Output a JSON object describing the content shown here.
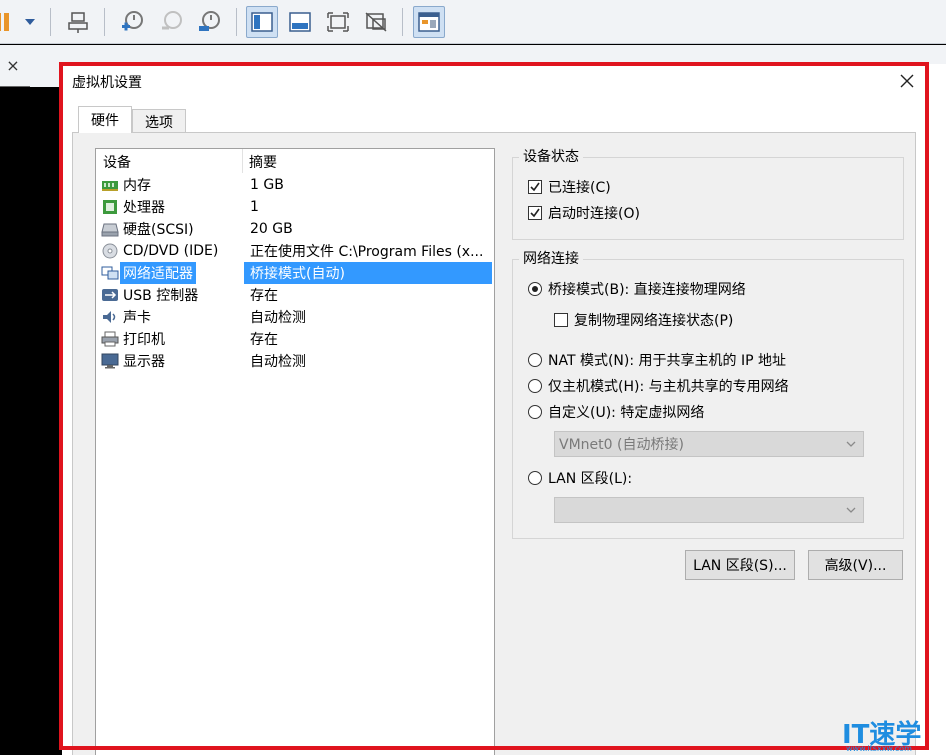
{
  "toolbar": {
    "buttons": [
      "pause-icon",
      "dropdown-arrow-icon",
      "send-ctrl-alt-del-icon",
      "snapshot-take-icon",
      "snapshot-revert-icon",
      "snapshot-manager-icon",
      "console-view-icon",
      "quick-switch-icon",
      "fullscreen-icon",
      "unity-icon",
      "thumbnail-view-icon"
    ]
  },
  "tabstrip": {
    "close_glyph": "×"
  },
  "dialog": {
    "title": "虚拟机设置",
    "close_glyph": "✕",
    "tabs": [
      {
        "label": "硬件"
      },
      {
        "label": "选项"
      }
    ],
    "device_list": {
      "columns": [
        "设备",
        "摘要"
      ],
      "rows": [
        {
          "name": "内存",
          "summary": "1 GB",
          "icon": "memory-icon"
        },
        {
          "name": "处理器",
          "summary": "1",
          "icon": "cpu-icon"
        },
        {
          "name": "硬盘(SCSI)",
          "summary": "20 GB",
          "icon": "hard-disk-icon"
        },
        {
          "name": "CD/DVD (IDE)",
          "summary": "正在使用文件 C:\\Program Files (x...",
          "icon": "cd-dvd-icon"
        },
        {
          "name": "网络适配器",
          "summary": "桥接模式(自动)",
          "icon": "network-adapter-icon",
          "selected": true
        },
        {
          "name": "USB 控制器",
          "summary": "存在",
          "icon": "usb-icon"
        },
        {
          "name": "声卡",
          "summary": "自动检测",
          "icon": "sound-card-icon"
        },
        {
          "name": "打印机",
          "summary": "存在",
          "icon": "printer-icon"
        },
        {
          "name": "显示器",
          "summary": "自动检测",
          "icon": "display-icon"
        }
      ]
    },
    "device_status": {
      "title": "设备状态",
      "connected": {
        "label": "已连接(C)",
        "checked": true
      },
      "connect_on_start": {
        "label": "启动时连接(O)",
        "checked": true
      }
    },
    "network": {
      "title": "网络连接",
      "bridged": {
        "label": "桥接模式(B): 直接连接物理网络",
        "selected": true
      },
      "replicate": {
        "label": "复制物理网络连接状态(P)",
        "checked": false
      },
      "nat": {
        "label": "NAT 模式(N): 用于共享主机的 IP 地址",
        "selected": false
      },
      "host_only": {
        "label": "仅主机模式(H): 与主机共享的专用网络",
        "selected": false
      },
      "custom": {
        "label": "自定义(U): 特定虚拟网络",
        "selected": false
      },
      "custom_select_value": "VMnet0 (自动桥接)",
      "lan": {
        "label": "LAN 区段(L):",
        "selected": false
      },
      "lan_select_value": ""
    },
    "buttons": {
      "lan_segments": "LAN 区段(S)...",
      "advanced": "高级(V)..."
    }
  },
  "watermark": {
    "text": "IT速学网",
    "sub": "www.itsxxw.com"
  },
  "colors": {
    "highlight": "#e0141e",
    "selection": "#3399ff",
    "watermark": "#1f8de0"
  }
}
